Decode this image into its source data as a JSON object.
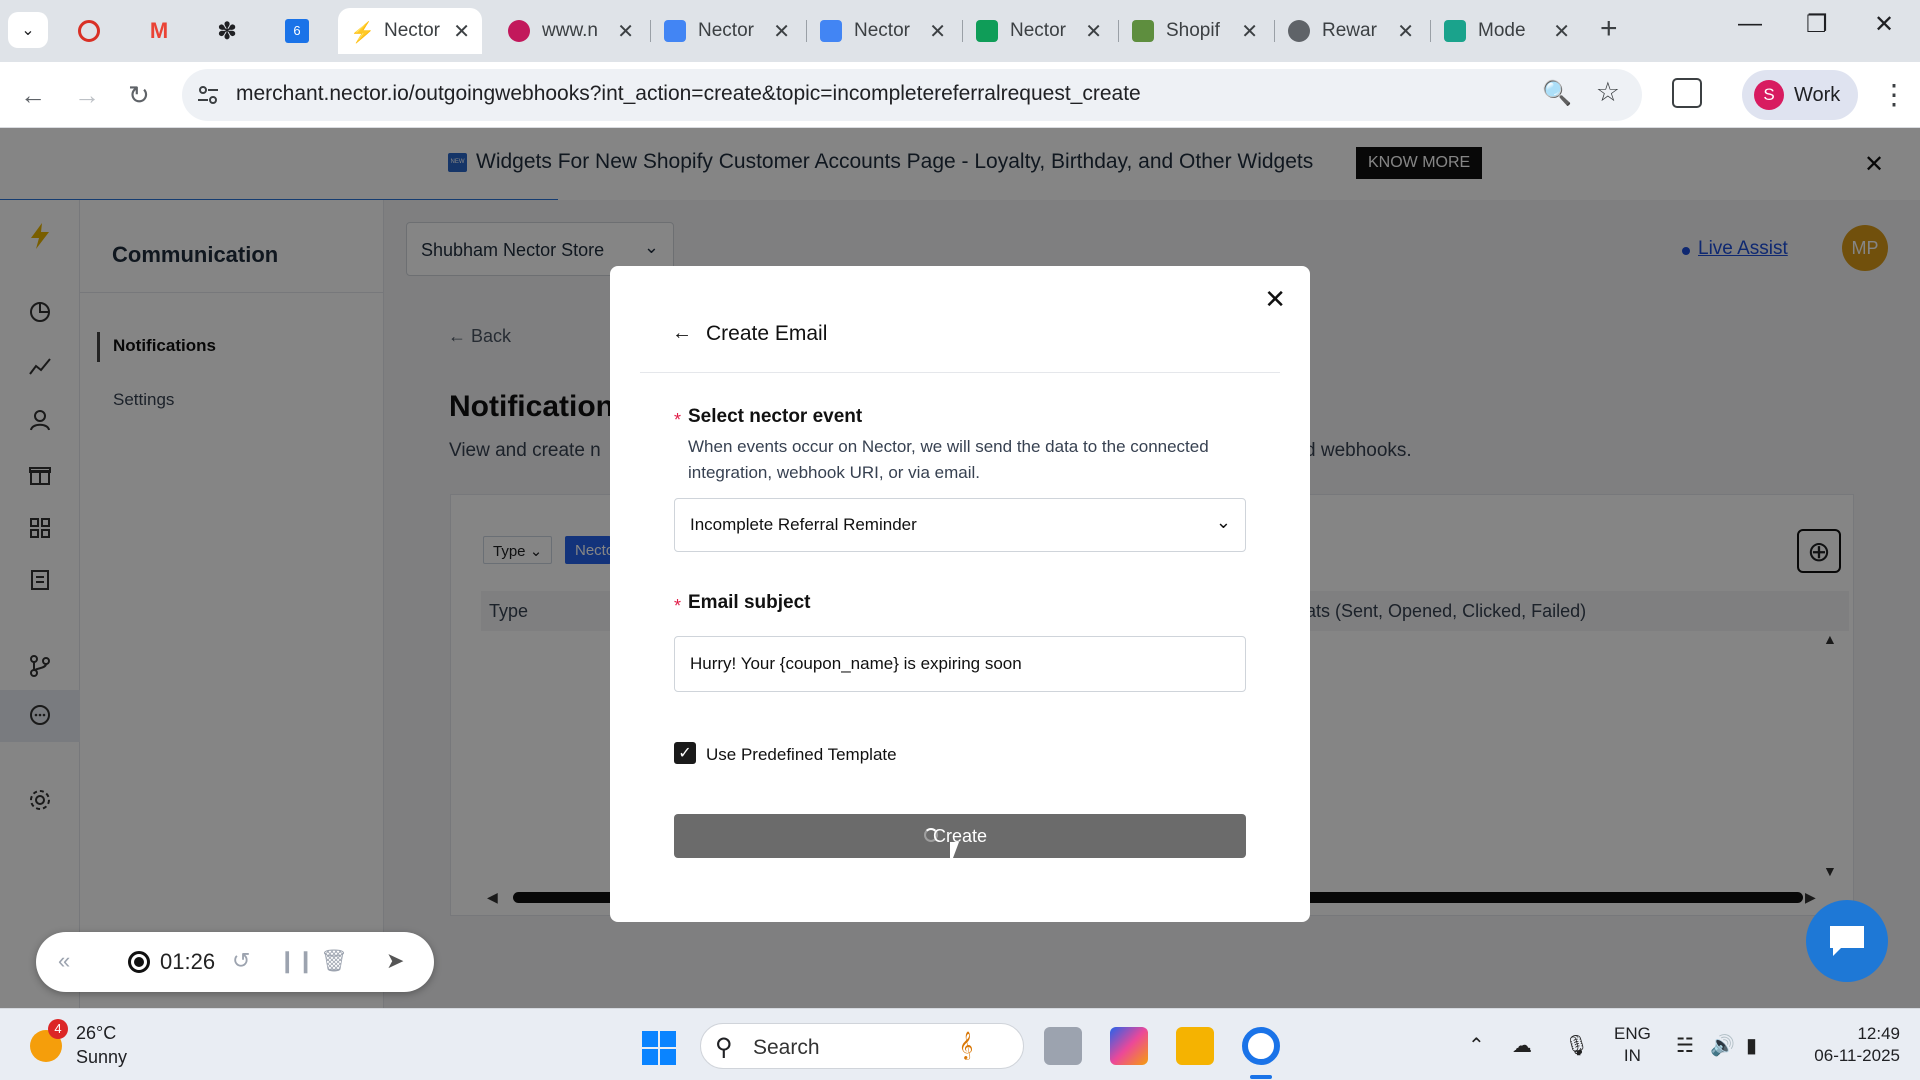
{
  "browser": {
    "tabs": [
      {
        "title": "",
        "favicon_color": "#d93025",
        "pinned": true
      },
      {
        "title": "",
        "favicon_color": "#ea4335",
        "pinned": true
      },
      {
        "title": "",
        "favicon_color": "#202124",
        "pinned": true
      },
      {
        "title": "",
        "favicon_color": "#1a73e8",
        "pinned": true
      },
      {
        "title": "Nector",
        "favicon_color": "#fbbc04",
        "active": true
      },
      {
        "title": "www.n",
        "favicon_color": "#c2185b"
      },
      {
        "title": "Nector",
        "favicon_color": "#4285f4"
      },
      {
        "title": "Nector",
        "favicon_color": "#4285f4"
      },
      {
        "title": "Nector",
        "favicon_color": "#0f9d58"
      },
      {
        "title": "Shopif",
        "favicon_color": "#5e8e3e"
      },
      {
        "title": "Rewar",
        "favicon_color": "#5f6368"
      },
      {
        "title": "Mode",
        "favicon_color": "#1aa38c"
      }
    ],
    "url": "merchant.nector.io/outgoingwebhooks?int_action=create&topic=incompletereferralrequest_create",
    "profile_initial": "S",
    "profile_label": "Work"
  },
  "announcement": {
    "badge": "NEW",
    "text": "Widgets For New Shopify Customer Accounts Page - Loyalty, Birthday, and Other Widgets",
    "cta": "KNOW MORE"
  },
  "sidebar": {
    "title": "Communication",
    "items": [
      {
        "label": "Notifications",
        "selected": true
      },
      {
        "label": "Settings",
        "selected": false
      }
    ]
  },
  "header": {
    "store": "Shubham Nector Store",
    "live_assist": "Live Assist",
    "avatar": "MP"
  },
  "main": {
    "back": "Back",
    "title": "Notifications",
    "description_start": "View and create n",
    "description_end": "d webhooks.",
    "filter_type": "Type",
    "filter_chip": "Necto",
    "col_type": "Type",
    "col_stats": "Stats (Sent, Opened, Clicked, Failed)"
  },
  "modal": {
    "title": "Create Email",
    "event_label": "Select nector event",
    "event_help": "When events occur on Nector, we will send the data to the connected integration, webhook URI, or via email.",
    "event_value": "Incomplete Referral Reminder",
    "subject_label": "Email subject",
    "subject_value": "Hurry! Your {coupon_name} is expiring soon",
    "template_label": "Use Predefined Template",
    "template_checked": true,
    "create_label": "Create"
  },
  "recorder": {
    "time": "01:26"
  },
  "taskbar": {
    "temperature": "26°C",
    "condition": "Sunny",
    "weather_badge": "4",
    "search": "Search",
    "lang_top": "ENG",
    "lang_bottom": "IN",
    "time": "12:49",
    "date": "06-11-2025"
  }
}
